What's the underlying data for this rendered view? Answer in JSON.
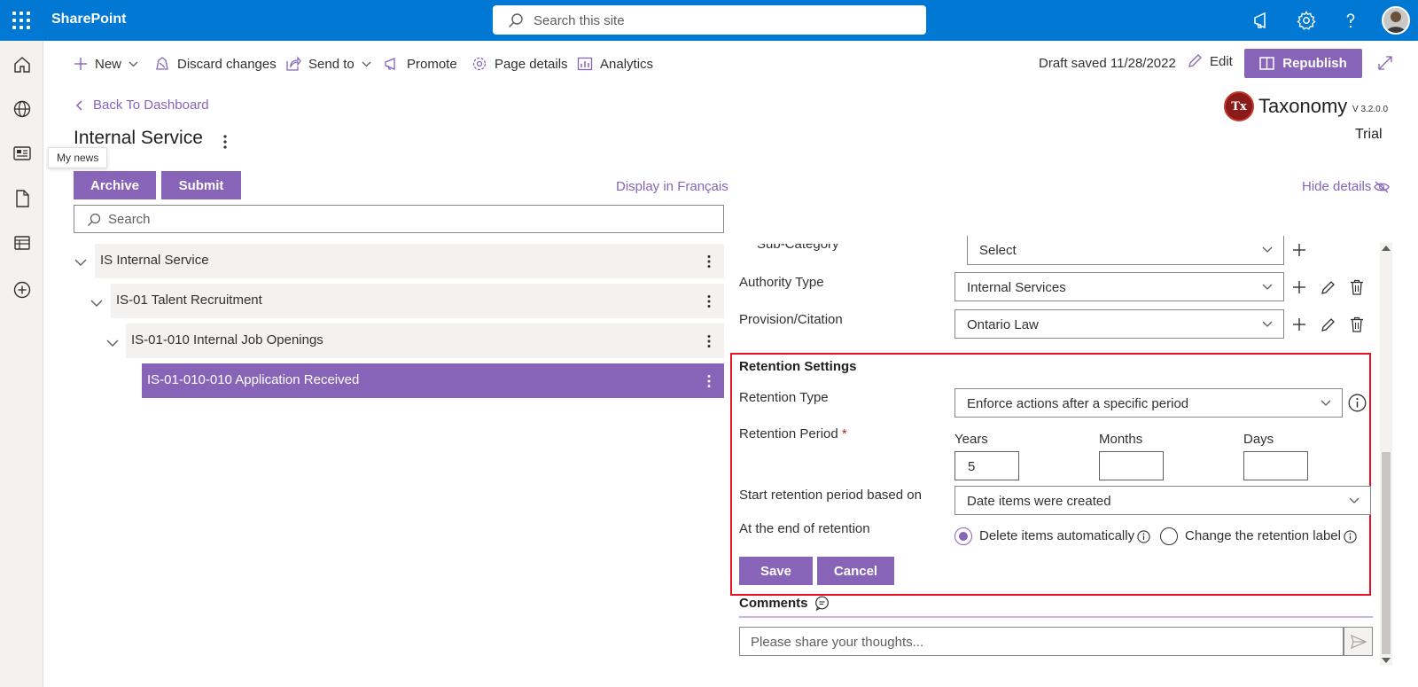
{
  "suite": {
    "app_name": "SharePoint",
    "search_placeholder": "Search this site"
  },
  "rail": {
    "tooltip": "My news"
  },
  "command_bar": {
    "new": "New",
    "discard": "Discard changes",
    "send_to": "Send to",
    "promote": "Promote",
    "page_details": "Page details",
    "analytics": "Analytics",
    "draft_status": "Draft saved 11/28/2022",
    "edit": "Edit",
    "republish": "Republish"
  },
  "header": {
    "back": "Back To Dashboard",
    "title": "Internal Service",
    "logo_mark": "Tx",
    "product": "Taxonomy",
    "version": "V 3.2.0.0",
    "license": "Trial"
  },
  "actions": {
    "archive": "Archive",
    "submit": "Submit",
    "display_language": "Display in Français",
    "hide_details": "Hide details"
  },
  "tree": {
    "search_placeholder": "Search",
    "nodes": [
      {
        "label": "IS Internal Service",
        "expanded": true,
        "selected": false
      },
      {
        "label": "IS-01 Talent Recruitment",
        "expanded": true,
        "selected": false
      },
      {
        "label": "IS-01-010 Internal Job Openings",
        "expanded": true,
        "selected": false
      },
      {
        "label": "IS-01-010-010 Application Received",
        "selected": true
      }
    ]
  },
  "details": {
    "sub_category_label": "Sub-Category",
    "sub_category_value": "Select",
    "authority_type_label": "Authority Type",
    "authority_type_value": "Internal Services",
    "provision_label": "Provision/Citation",
    "provision_value": "Ontario Law"
  },
  "retention": {
    "section_title": "Retention Settings",
    "type_label": "Retention Type",
    "type_value": "Enforce actions after a specific period",
    "period_label": "Retention Period",
    "required_mark": "*",
    "years_label": "Years",
    "years_value": "5",
    "months_label": "Months",
    "months_value": "",
    "days_label": "Days",
    "days_value": "",
    "start_label": "Start retention period based on",
    "start_value": "Date items were created",
    "end_label": "At the end of retention",
    "option_delete": "Delete items automatically",
    "option_change": "Change the retention label",
    "selected_option": "delete",
    "save": "Save",
    "cancel": "Cancel"
  },
  "comments": {
    "title": "Comments",
    "placeholder": "Please share your thoughts..."
  },
  "colors": {
    "suite_blue": "#0078d4",
    "accent_purple": "#8764b8",
    "highlight_red": "#e81123"
  }
}
